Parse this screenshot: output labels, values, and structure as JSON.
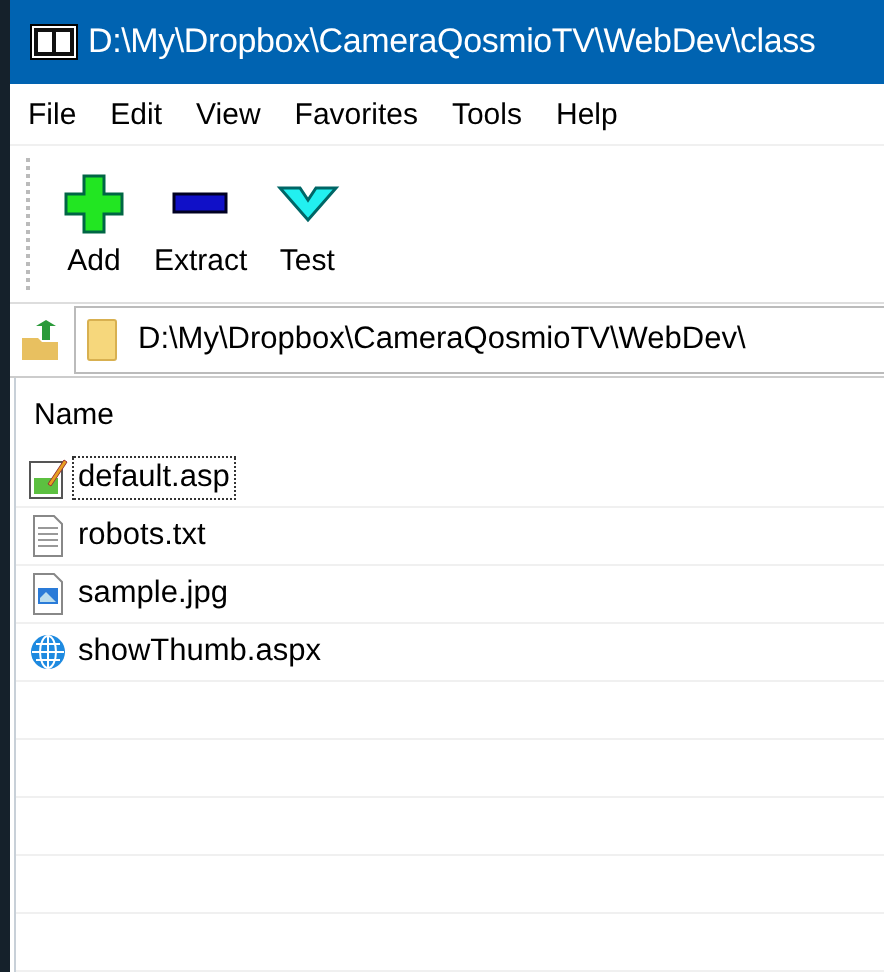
{
  "window": {
    "title": "D:\\My\\Dropbox\\CameraQosmioTV\\WebDev\\class"
  },
  "menu": [
    "File",
    "Edit",
    "View",
    "Favorites",
    "Tools",
    "Help"
  ],
  "toolbar": [
    {
      "kind": "add",
      "label": "Add"
    },
    {
      "kind": "extract",
      "label": "Extract"
    },
    {
      "kind": "test",
      "label": "Test"
    }
  ],
  "address": {
    "value": "D:\\My\\Dropbox\\CameraQosmioTV\\WebDev\\"
  },
  "table": {
    "columns": [
      "Name"
    ],
    "rows": [
      {
        "kind": "script",
        "name": "default.asp",
        "focused": true
      },
      {
        "kind": "text",
        "name": "robots.txt",
        "focused": false
      },
      {
        "kind": "image",
        "name": "sample.jpg",
        "focused": false
      },
      {
        "kind": "web",
        "name": "showThumb.aspx",
        "focused": false
      }
    ]
  }
}
